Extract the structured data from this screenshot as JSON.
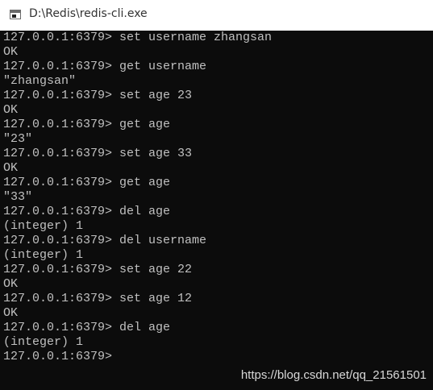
{
  "window": {
    "title": "D:\\Redis\\redis-cli.exe",
    "icon": "console-window-icon"
  },
  "console": {
    "colors": {
      "background": "#0c0c0c",
      "text": "#c0c0c0"
    },
    "lines": [
      "127.0.0.1:6379> set username zhangsan",
      "OK",
      "127.0.0.1:6379> get username",
      "\"zhangsan\"",
      "127.0.0.1:6379> set age 23",
      "OK",
      "127.0.0.1:6379> get age",
      "\"23\"",
      "127.0.0.1:6379> set age 33",
      "OK",
      "127.0.0.1:6379> get age",
      "\"33\"",
      "127.0.0.1:6379> del age",
      "(integer) 1",
      "127.0.0.1:6379> del username",
      "(integer) 1",
      "127.0.0.1:6379> set age 22",
      "OK",
      "127.0.0.1:6379> set age 12",
      "OK",
      "127.0.0.1:6379> del age",
      "(integer) 1"
    ],
    "prompt": "127.0.0.1:6379>"
  },
  "watermark": "https://blog.csdn.net/qq_21561501"
}
